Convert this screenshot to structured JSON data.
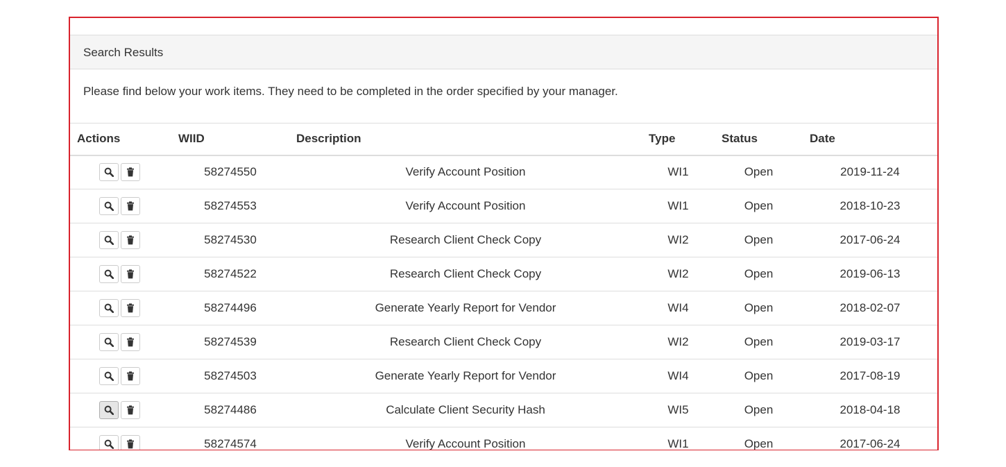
{
  "panel": {
    "title": "Search Results",
    "intro": "Please find below your work items. They need to be completed in the order specified by your manager."
  },
  "table": {
    "headers": {
      "actions": "Actions",
      "wiid": "WIID",
      "description": "Description",
      "type": "Type",
      "status": "Status",
      "date": "Date"
    },
    "rows": [
      {
        "wiid": "58274550",
        "description": "Verify Account Position",
        "type": "WI1",
        "status": "Open",
        "date": "2019-11-24"
      },
      {
        "wiid": "58274553",
        "description": "Verify Account Position",
        "type": "WI1",
        "status": "Open",
        "date": "2018-10-23"
      },
      {
        "wiid": "58274530",
        "description": "Research Client Check Copy",
        "type": "WI2",
        "status": "Open",
        "date": "2017-06-24"
      },
      {
        "wiid": "58274522",
        "description": "Research Client Check Copy",
        "type": "WI2",
        "status": "Open",
        "date": "2019-06-13"
      },
      {
        "wiid": "58274496",
        "description": "Generate Yearly Report for Vendor",
        "type": "WI4",
        "status": "Open",
        "date": "2018-02-07"
      },
      {
        "wiid": "58274539",
        "description": "Research Client Check Copy",
        "type": "WI2",
        "status": "Open",
        "date": "2019-03-17"
      },
      {
        "wiid": "58274503",
        "description": "Generate Yearly Report for Vendor",
        "type": "WI4",
        "status": "Open",
        "date": "2017-08-19"
      },
      {
        "wiid": "58274486",
        "description": "Calculate Client Security Hash",
        "type": "WI5",
        "status": "Open",
        "date": "2018-04-18"
      },
      {
        "wiid": "58274574",
        "description": "Verify Account Position",
        "type": "WI1",
        "status": "Open",
        "date": "2017-06-24"
      }
    ],
    "row_icons": {
      "view": "search-icon",
      "delete": "trash-icon"
    }
  }
}
